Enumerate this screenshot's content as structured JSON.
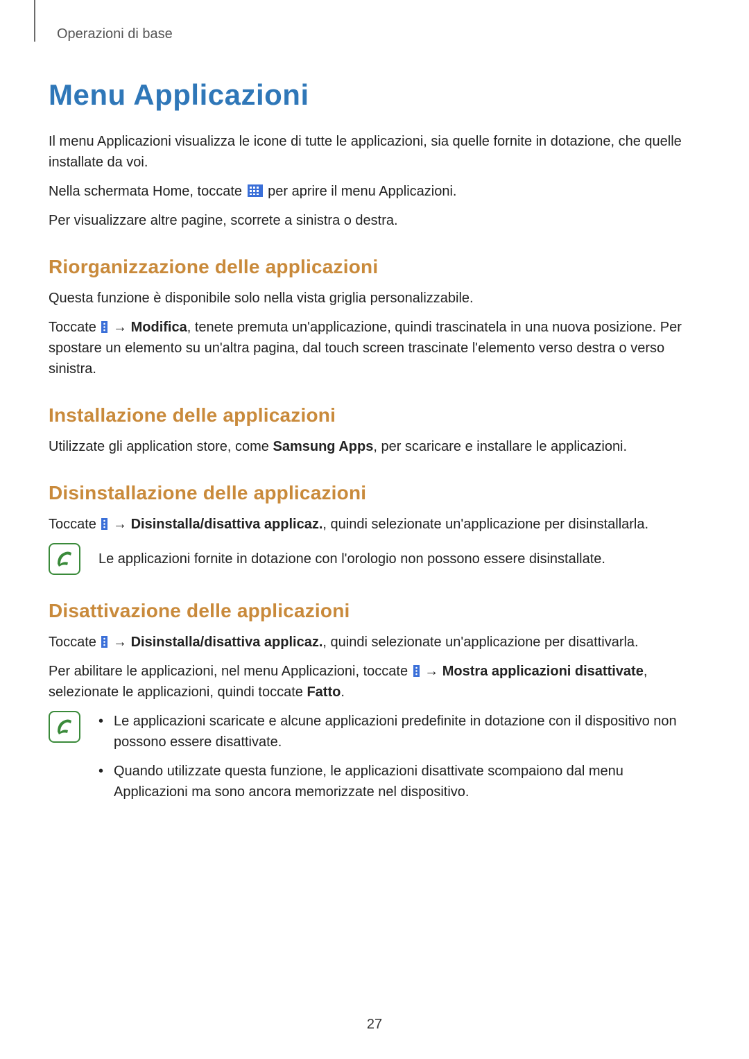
{
  "breadcrumb": "Operazioni di base",
  "title": "Menu Applicazioni",
  "intro": {
    "p1": "Il menu Applicazioni visualizza le icone di tutte le applicazioni, sia quelle fornite in dotazione, che quelle installate da voi.",
    "p2a": "Nella schermata Home, toccate ",
    "p2b": " per aprire il menu Applicazioni.",
    "p3": "Per visualizzare altre pagine, scorrete a sinistra o destra."
  },
  "sections": {
    "reorg": {
      "heading": "Riorganizzazione delle applicazioni",
      "p1": "Questa funzione è disponibile solo nella vista griglia personalizzabile.",
      "p2a": "Toccate ",
      "p2arrow": " → ",
      "p2bold": "Modifica",
      "p2b": ", tenete premuta un'applicazione, quindi trascinatela in una nuova posizione. Per spostare un elemento su un'altra pagina, dal touch screen trascinate l'elemento verso destra o verso sinistra."
    },
    "install": {
      "heading": "Installazione delle applicazioni",
      "p1a": "Utilizzate gli application store, come ",
      "p1bold": "Samsung Apps",
      "p1b": ", per scaricare e installare le applicazioni."
    },
    "uninstall": {
      "heading": "Disinstallazione delle applicazioni",
      "p1a": "Toccate ",
      "p1arrow": " → ",
      "p1bold": "Disinstalla/disattiva applicaz.",
      "p1b": ", quindi selezionate un'applicazione per disinstallarla.",
      "note": "Le applicazioni fornite in dotazione con l'orologio non possono essere disinstallate."
    },
    "disable": {
      "heading": "Disattivazione delle applicazioni",
      "p1a": "Toccate ",
      "p1arrow": " → ",
      "p1bold": "Disinstalla/disattiva applicaz.",
      "p1b": ", quindi selezionate un'applicazione per disattivarla.",
      "p2a": "Per abilitare le applicazioni, nel menu Applicazioni, toccate ",
      "p2arrow": " → ",
      "p2bold": "Mostra applicazioni disattivate",
      "p2b": ", selezionate le applicazioni, quindi toccate ",
      "p2bold2": "Fatto",
      "p2c": ".",
      "note_items": [
        "Le applicazioni scaricate e alcune applicazioni predefinite in dotazione con il dispositivo non possono essere disattivate.",
        "Quando utilizzate questa funzione, le applicazioni disattivate scompaiono dal menu Applicazioni ma sono ancora memorizzate nel dispositivo."
      ]
    }
  },
  "page_number": "27"
}
